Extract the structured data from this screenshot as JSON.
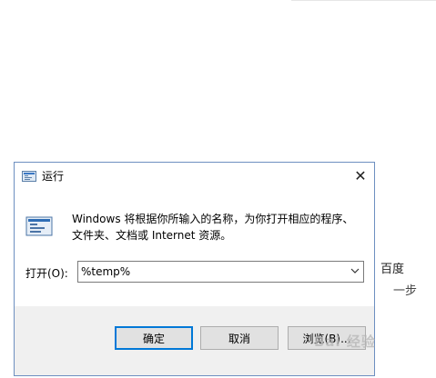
{
  "dialog": {
    "title": "运行",
    "close_symbol": "✕",
    "description_line1": "Windows 将根据你所输入的名称，为你打开相应的程序、",
    "description_line2": "文件夹、文档或 Internet 资源。",
    "open_label": "打开(O):",
    "open_value": "%temp%",
    "buttons": {
      "ok": "确定",
      "cancel": "取消",
      "browse": "浏览(B)..."
    }
  },
  "background": {
    "text1": "百度",
    "text2": "一步",
    "watermark": "Bai 经验"
  },
  "icons": {
    "title_icon": "run-app-icon",
    "run_icon": "run-app-icon",
    "dropdown": "chevron-down-icon"
  },
  "colors": {
    "accent": "#0078d7",
    "dialog_border": "#6d8fc0",
    "footer_bg": "#f0f0f0",
    "button_bg": "#e1e1e1"
  }
}
